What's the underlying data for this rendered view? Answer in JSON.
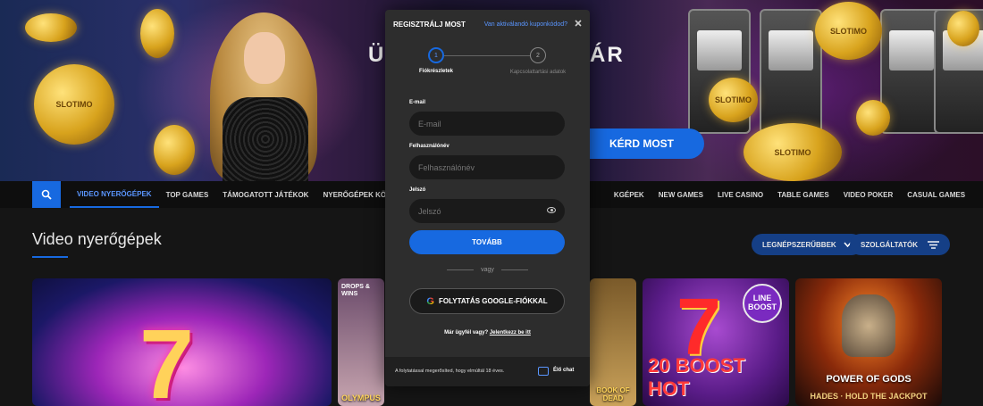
{
  "hero": {
    "title_left": "ÜD",
    "title_right": "ÁR",
    "cta_label": "KÉRD MOST",
    "coin_text": "SLOTIMO"
  },
  "nav": {
    "items": [
      {
        "label": "VIDEO NYERŐGÉPEK",
        "active": true
      },
      {
        "label": "TOP GAMES"
      },
      {
        "label": "TÁMOGATOTT JÁTÉKOK"
      },
      {
        "label": "NYERŐGÉPEK KÖNYVE"
      },
      {
        "label": "KGÉPEK"
      },
      {
        "label": "NEW GAMES"
      },
      {
        "label": "LIVE CASINO"
      },
      {
        "label": "TABLE GAMES"
      },
      {
        "label": "VIDEO POKER"
      },
      {
        "label": "CASUAL GAMES"
      }
    ]
  },
  "section": {
    "title": "Video nyerőgépek",
    "sort_label": "LEGNÉPSZERŰBBEK",
    "providers_label": "SZOLGÁLTATÓK"
  },
  "cards": {
    "card2_badge": "DROPS & WINS",
    "card2_title": "OLYMPUS",
    "card3_title": "BOOK OF DEAD",
    "card4_badge": "LINE BOOST",
    "card4_title": "20 BOOST HOT",
    "card5_title": "POWER OF GODS",
    "card5_sub1": "HADES",
    "card5_sub2": "HOLD THE JACKPOT"
  },
  "modal": {
    "title": "REGISZTRÁLJ MOST",
    "coupon_link": "Van aktiválandó kuponkódod?",
    "steps": [
      {
        "number": "1",
        "label": "Fiókrészletek"
      },
      {
        "number": "2",
        "label": "Kapcsolattartási adatok"
      }
    ],
    "email_label": "E-mail",
    "email_placeholder": "E-mail",
    "username_label": "Felhasználónév",
    "username_placeholder": "Felhasználónév",
    "password_label": "Jelszó",
    "password_placeholder": "Jelszó",
    "continue_label": "TOVÁBB",
    "or_label": "vagy",
    "google_label": "FOLYTATÁS GOOGLE-FIÓKKAL",
    "login_prompt": "Már ügyfél vagy?",
    "login_link": "Jelentkezz be itt",
    "age_note": "A folytatással megerősíted, hogy elmúltál 18 éves.",
    "chat_label": "Élő chat"
  },
  "colors": {
    "accent": "#1769e0",
    "background": "#151515",
    "modal_bg": "#2d2d2d"
  }
}
